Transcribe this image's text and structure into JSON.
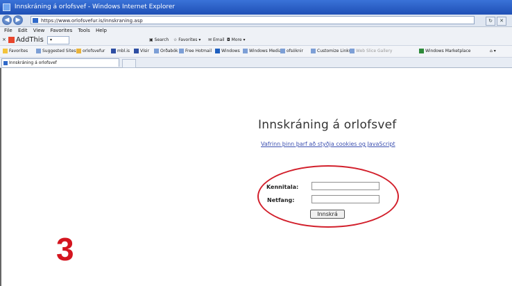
{
  "window": {
    "title": "Innskráning á orlofsvef - Windows Internet Explorer"
  },
  "address_bar": {
    "url": "https://www.orlofsvefur.is/innskraning.asp"
  },
  "menu": {
    "items": [
      "File",
      "Edit",
      "View",
      "Favorites",
      "Tools",
      "Help"
    ]
  },
  "toolbar": {
    "addthis_label": "AddThis",
    "search_label": "Search",
    "favorites_label": "Favorites",
    "email_label": "Email",
    "more_label": "More"
  },
  "favorites": {
    "label": "Favorites",
    "items": [
      "Suggested Sites",
      "orlofsvefur",
      "mbl.is",
      "Vísir",
      "Orðabók",
      "Free Hotmail",
      "Windows",
      "Windows Media",
      "ofsóknir",
      "Customize Links",
      "Web Slice Gallery",
      "Windows Marketplace"
    ]
  },
  "tab": {
    "title": "Innskráning á orlofsvef"
  },
  "page": {
    "heading": "Innskráning á orlofsvef",
    "cookies_link": "Vafrinn þinn þarf að styðja cookies og JavaScript",
    "kennitala_label": "Kennitala:",
    "netfang_label": "Netfang:",
    "login_button": "Innskrá"
  },
  "annotation": {
    "step_number": "3",
    "color": "#d4151f"
  }
}
